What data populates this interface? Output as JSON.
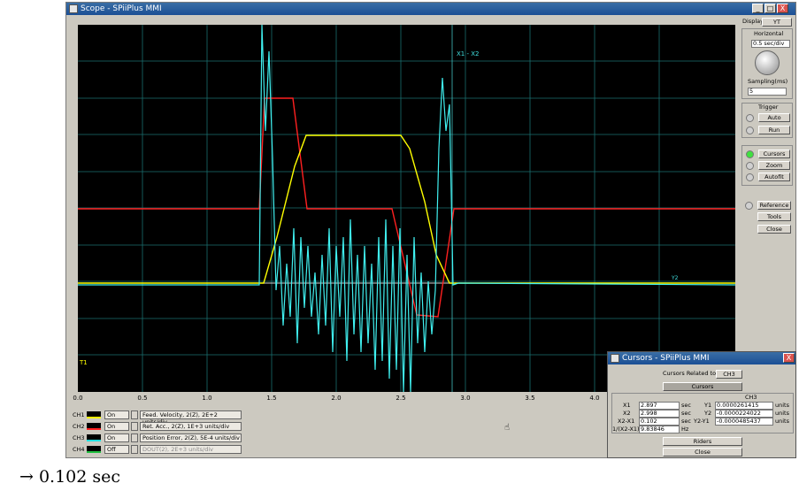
{
  "window": {
    "title": "Scope - SPiiPlus MMI",
    "buttons": [
      "_",
      "□",
      "X"
    ]
  },
  "plot": {
    "cursor_label": "X1 - X2",
    "marker_t1": "T1",
    "marker_y2": "Y2",
    "x_ticks": [
      "0.0",
      "0.5",
      "1.0",
      "1.5",
      "2.0",
      "2.5",
      "3.0",
      "3.5",
      "4.0"
    ]
  },
  "channels": [
    {
      "id": "CH1",
      "state": "On",
      "desc": "Feed. Velocity, 2(Z), 2E+2 units/div",
      "color": "#ffff00"
    },
    {
      "id": "CH2",
      "state": "On",
      "desc": "Ret. Acc., 2(Z), 1E+3 units/div",
      "color": "#ff2020"
    },
    {
      "id": "CH3",
      "state": "On",
      "desc": "Position Error, 2(Z), 5E-4 units/div",
      "color": "#20e0e0"
    },
    {
      "id": "CH4",
      "state": "Off",
      "desc": "DOUT(2), 2E+3 units/div",
      "color": "#20c040"
    }
  ],
  "right_panel": {
    "display_label": "Display",
    "display_value": "YT",
    "horizontal_label": "Horizontal",
    "horizontal_value": "0.5 sec/div",
    "sampling_label": "Sampling(ms)",
    "sampling_value": "5",
    "trigger_label": "Trigger",
    "auto_label": "Auto",
    "run_label": "Run",
    "cursors_label": "Cursors",
    "zoom_label": "Zoom",
    "autofit_label": "Autofit",
    "reference_label": "Reference",
    "tools_label": "Tools",
    "close_label": "Close"
  },
  "cursors_window": {
    "title": "Cursors - SPiiPlus MMI",
    "related_label": "Cursors Related to",
    "related_value": "CH3",
    "cursors_button": "Cursors",
    "channel_header": "CH3",
    "x1_label": "X1",
    "x1_value": "2.897",
    "x1_unit": "sec",
    "x2_label": "X2",
    "x2_value": "2.998",
    "x2_unit": "sec",
    "dx_label": "X2-X1",
    "dx_value": "0.102",
    "dx_unit": "sec",
    "inv_label": "1/(X2-X1)",
    "inv_value": "9.83846",
    "inv_unit": "Hz",
    "y1_label": "Y1",
    "y1_value": "0.0000261415",
    "y1_unit": "units",
    "y2_label": "Y2",
    "y2_value": "-0.0000224022",
    "y2_unit": "units",
    "dy_label": "Y2-Y1",
    "dy_value": "-0.0000485437",
    "dy_unit": "units",
    "riders_label": "Riders",
    "close_label": "Close"
  },
  "annotation": "→ 0.102 sec"
}
